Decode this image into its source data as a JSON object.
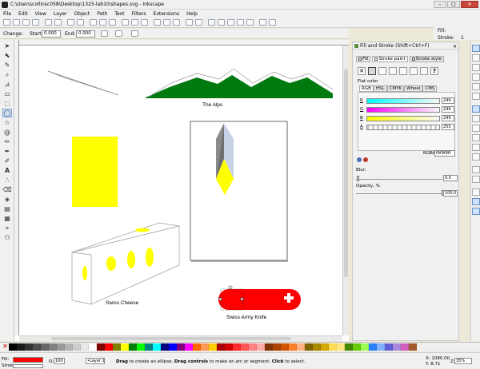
{
  "window": {
    "title": "C:\\Users\\collinsc058\\Desktop\\1325-lab10\\shapes.svg - Inkscape",
    "minimize": "–",
    "maximize": "□",
    "close": "✕"
  },
  "menu": [
    "File",
    "Edit",
    "View",
    "Layer",
    "Object",
    "Path",
    "Text",
    "Filters",
    "Extensions",
    "Help"
  ],
  "controls": {
    "change_label": "Change:",
    "start_label": "Start:",
    "start_value": "0.000",
    "end_label": "End:",
    "end_value": "0.000"
  },
  "right_strip": {
    "fill_label": "Fill:",
    "stroke_label": "Stroke:",
    "stroke_value": "1"
  },
  "canvas": {
    "labels": {
      "alps": "The Alps",
      "cheese": "Swiss Cheese",
      "knife": "Swiss Army Knife"
    },
    "colors": {
      "mountains": "#007a0f",
      "yellow": "#ffff00",
      "knife": "#ff0000"
    }
  },
  "dock": {
    "title": "Fill and Stroke (Shift+Ctrl+F)",
    "close": "✕",
    "tabs": [
      "Fill",
      "Stroke paint",
      "Stroke style"
    ],
    "flat_color_label": "Flat color",
    "color_models": [
      "RGB",
      "HSL",
      "CMYK",
      "Wheel",
      "CMS"
    ],
    "channels": [
      {
        "label": "R",
        "value": "249"
      },
      {
        "label": "G",
        "value": "249"
      },
      {
        "label": "B",
        "value": "249"
      },
      {
        "label": "A",
        "value": "255"
      }
    ],
    "rgba_label": "RGBA:",
    "rgba_value": "f9f9f9ff",
    "blur_label": "Blur:",
    "blur_value": "0.0",
    "opacity_label": "Opacity, %",
    "opacity_value": "100.0"
  },
  "status": {
    "fill_label": "Fill:",
    "stroke_label": "Stroke:",
    "opacity_label": "O:",
    "opacity_value": "100",
    "layer_value": "•Layer 1",
    "hint_1": "Drag",
    "hint_2": " to create an ellipse. ",
    "hint_3": "Drag controls",
    "hint_4": " to make an arc or segment. ",
    "hint_5": "Click",
    "hint_6": " to select.",
    "x": "X: 1080.00",
    "y": "Y:   8.71",
    "zoom_label": "Z:",
    "zoom_value": "35%"
  }
}
